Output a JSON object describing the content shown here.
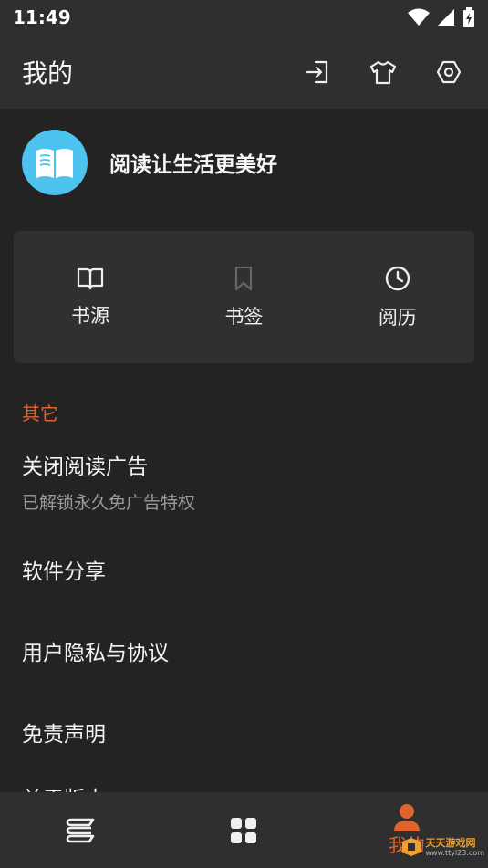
{
  "status_bar": {
    "time": "11:49"
  },
  "app_bar": {
    "title": "我的",
    "actions": [
      "import-icon",
      "theme-shirt-icon",
      "settings-icon"
    ]
  },
  "profile": {
    "slogan": "阅读让生活更美好",
    "avatar_icon": "book-icon",
    "avatar_color": "#4fc3f0"
  },
  "quick_actions": [
    {
      "label": "书源",
      "icon": "book-open-icon"
    },
    {
      "label": "书签",
      "icon": "bookmark-icon"
    },
    {
      "label": "阅历",
      "icon": "clock-icon"
    }
  ],
  "section": {
    "title": "其它"
  },
  "menu": [
    {
      "label": "关闭阅读广告",
      "sub": "已解锁永久免广告特权"
    },
    {
      "label": "软件分享"
    },
    {
      "label": "用户隐私与协议"
    },
    {
      "label": "免责声明"
    },
    {
      "label": "关于版本"
    }
  ],
  "bottom_nav": {
    "tabs": [
      {
        "icon": "bookshelf-icon",
        "label": ""
      },
      {
        "icon": "grid-icon",
        "label": ""
      },
      {
        "icon": "person-icon",
        "label": "我的"
      }
    ],
    "active_color": "#e0622e"
  },
  "watermark": {
    "brand": "天天游戏网",
    "url": "www.ttyl23.com"
  }
}
